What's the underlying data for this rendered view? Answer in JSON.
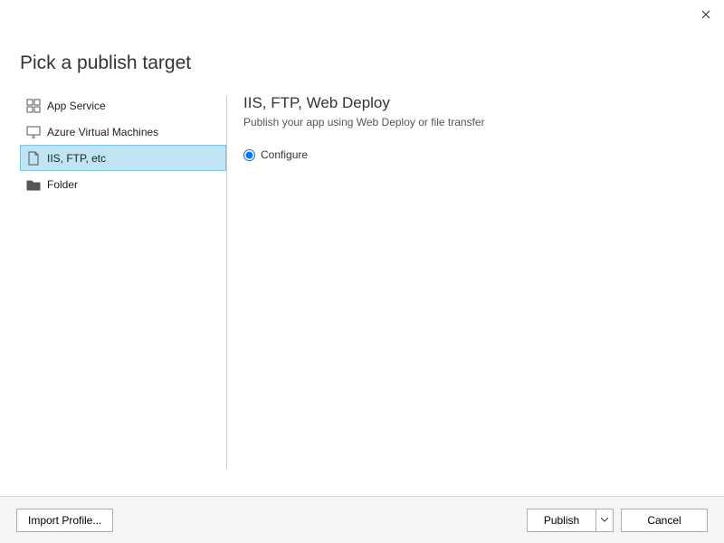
{
  "header": {
    "title": "Pick a publish target"
  },
  "sidebar": {
    "items": [
      {
        "label": "App Service"
      },
      {
        "label": "Azure Virtual Machines"
      },
      {
        "label": "IIS, FTP, etc"
      },
      {
        "label": "Folder"
      }
    ]
  },
  "detail": {
    "title": "IIS, FTP, Web Deploy",
    "subtitle": "Publish your app using Web Deploy or file transfer",
    "options": [
      {
        "label": "Configure"
      }
    ]
  },
  "footer": {
    "import_label": "Import Profile...",
    "publish_label": "Publish",
    "cancel_label": "Cancel"
  }
}
